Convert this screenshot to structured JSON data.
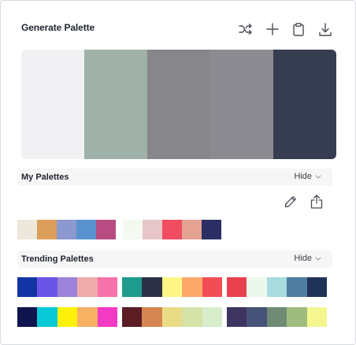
{
  "header": {
    "title": "Generate Palette",
    "icons": [
      "shuffle-icon",
      "plus-icon",
      "clipboard-icon",
      "download-icon"
    ]
  },
  "generated_palette": [
    "#f1f1f3",
    "#9fb1a8",
    "#87868b",
    "#8d8b92",
    "#363d51"
  ],
  "my_palettes": {
    "title": "My Palettes",
    "hide_label": "Hide",
    "icons": [
      "pencil-icon",
      "share-icon"
    ],
    "palettes": [
      [
        "#ede8db",
        "#dc9f5b",
        "#8c98d0",
        "#5a92d0",
        "#b84b81"
      ],
      [
        "#f4f9f1",
        "#e7c6ca",
        "#f04d62",
        "#e6a291",
        "#2c2f64"
      ]
    ]
  },
  "trending_palettes": {
    "title": "Trending Palettes",
    "hide_label": "Hide",
    "palettes": [
      [
        "#1235a3",
        "#6b55e6",
        "#9c82d8",
        "#efaaaa",
        "#f673aa"
      ],
      [
        "#1e9b8c",
        "#2c3146",
        "#fdf684",
        "#fda96c",
        "#f24d55"
      ],
      [
        "#e8414d",
        "#ebf8ee",
        "#a8dcde",
        "#4e7da0",
        "#1f3358"
      ],
      [
        "#0f144d",
        "#08c9d6",
        "#fdf10a",
        "#f8b063",
        "#f33ac4"
      ],
      [
        "#5c1d25",
        "#d48750",
        "#eadc86",
        "#d6e3a8",
        "#d7edcc"
      ],
      [
        "#3e3460",
        "#475279",
        "#6f8a75",
        "#9fbc7e",
        "#f4f790"
      ]
    ]
  }
}
